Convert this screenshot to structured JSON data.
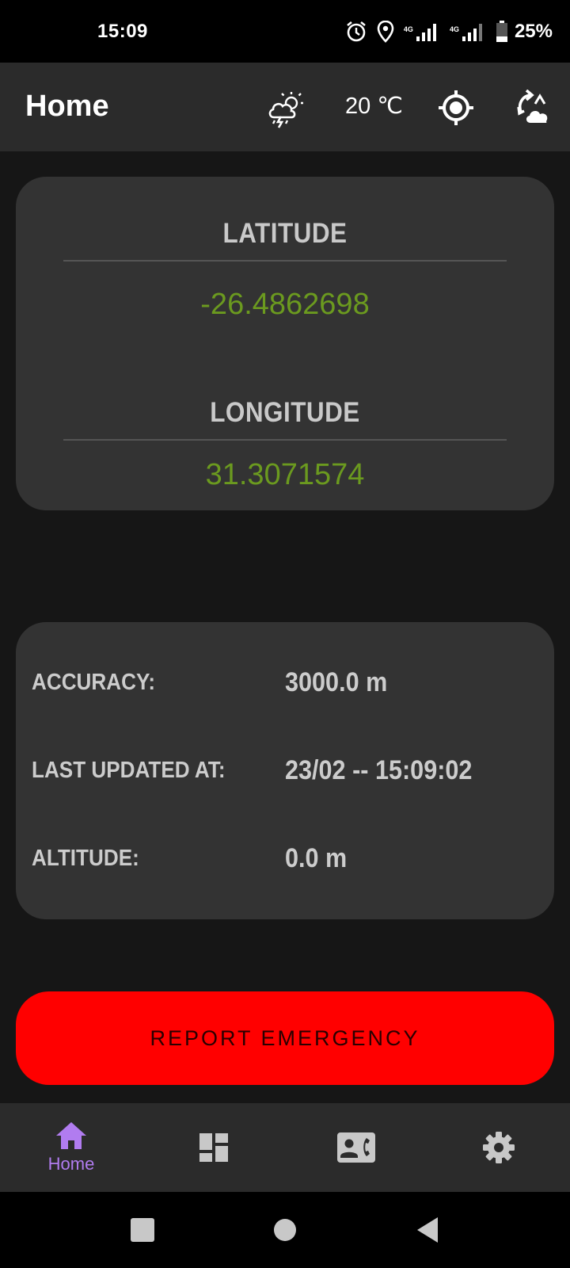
{
  "status_bar": {
    "time": "15:09",
    "network_label_1": "4G",
    "network_label_2": "4G",
    "battery": "25%",
    "icons": [
      "alarm-icon",
      "location-pin-icon",
      "signal-icon",
      "signal-icon",
      "battery-icon"
    ]
  },
  "app_bar": {
    "title": "Home",
    "weather_icon": "thunderstorm-sun-icon",
    "temperature": "20 ℃",
    "locate_icon": "gps-target-icon",
    "refresh_icon": "refresh-weather-icon"
  },
  "coordinates": {
    "latitude_heading": "LATITUDE",
    "latitude_value": "-26.4862698",
    "longitude_heading": "LONGITUDE",
    "longitude_value": "31.3071574"
  },
  "info": {
    "accuracy_label": "ACCURACY:",
    "accuracy_value": "3000.0 m",
    "updated_label": "LAST UPDATED AT:",
    "updated_value": "23/02 -- 15:09:02",
    "altitude_label": "ALTITUDE:",
    "altitude_value": "0.0 m"
  },
  "emergency_button": {
    "label": "REPORT EMERGENCY"
  },
  "bottom_nav": {
    "items": [
      {
        "label": "Home",
        "icon": "home-icon",
        "active": true
      },
      {
        "label": "",
        "icon": "dashboard-icon",
        "active": false
      },
      {
        "label": "",
        "icon": "contact-phone-icon",
        "active": false
      },
      {
        "label": "",
        "icon": "settings-gear-icon",
        "active": false
      }
    ]
  },
  "colors": {
    "accent": "#b17cf0",
    "coordinate_value": "#6b9a1f",
    "emergency": "#ff0000",
    "card": "#333333",
    "background": "#161616"
  }
}
